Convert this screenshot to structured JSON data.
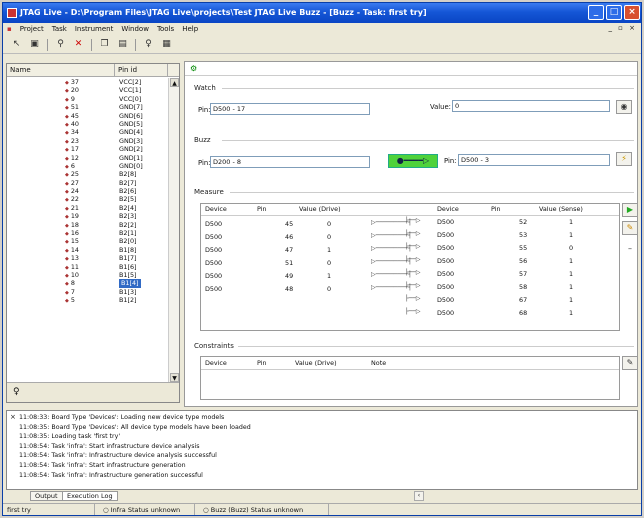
{
  "window": {
    "title": "JTAG Live - D:\\Program Files\\JTAG Live\\projects\\Test JTAG Live Buzz - [Buzz - Task: first try]"
  },
  "menu": [
    "Project",
    "Task",
    "Instrument",
    "Window",
    "Tools",
    "Help"
  ],
  "left_panel": {
    "col_name": "Name",
    "col_pin": "Pin id",
    "pins": [
      {
        "name": "37",
        "id": "VCC[2]"
      },
      {
        "name": "20",
        "id": "VCC[1]"
      },
      {
        "name": "9",
        "id": "VCC[0]"
      },
      {
        "name": "51",
        "id": "GND[7]"
      },
      {
        "name": "45",
        "id": "GND[6]"
      },
      {
        "name": "40",
        "id": "GND[5]"
      },
      {
        "name": "34",
        "id": "GND[4]"
      },
      {
        "name": "23",
        "id": "GND[3]"
      },
      {
        "name": "17",
        "id": "GND[2]"
      },
      {
        "name": "12",
        "id": "GND[1]"
      },
      {
        "name": "6",
        "id": "GND[0]"
      },
      {
        "name": "25",
        "id": "B2[8]"
      },
      {
        "name": "27",
        "id": "B2[7]"
      },
      {
        "name": "24",
        "id": "B2[6]"
      },
      {
        "name": "22",
        "id": "B2[5]"
      },
      {
        "name": "21",
        "id": "B2[4]"
      },
      {
        "name": "19",
        "id": "B2[3]"
      },
      {
        "name": "18",
        "id": "B2[2]"
      },
      {
        "name": "16",
        "id": "B2[1]"
      },
      {
        "name": "15",
        "id": "B2[0]"
      },
      {
        "name": "14",
        "id": "B1[8]"
      },
      {
        "name": "13",
        "id": "B1[7]"
      },
      {
        "name": "11",
        "id": "B1[6]"
      },
      {
        "name": "10",
        "id": "B1[5]"
      },
      {
        "name": "8",
        "id": "B1[4]",
        "selected": true
      },
      {
        "name": "7",
        "id": "B1[3]"
      },
      {
        "name": "5",
        "id": "B1[2]"
      }
    ]
  },
  "watch": {
    "group": "Watch",
    "pin_label": "Pin:",
    "pin_value": "D500 - 17",
    "value_label": "Value:",
    "value": "0"
  },
  "buzz": {
    "group": "Buzz",
    "pin_label": "Pin:",
    "pin_from": "D200 - 8",
    "pin_to": "D500 - 3"
  },
  "measure": {
    "group": "Measure",
    "left_headers": [
      "Device",
      "Pin",
      "Value (Drive)"
    ],
    "right_headers": [
      "Device",
      "Pin",
      "Value (Sense)"
    ],
    "drive": [
      [
        "D500",
        "45",
        "0"
      ],
      [
        "D500",
        "46",
        "0"
      ],
      [
        "D500",
        "47",
        "1"
      ],
      [
        "D500",
        "51",
        "0"
      ],
      [
        "D500",
        "49",
        "1"
      ],
      [
        "D500",
        "48",
        "0"
      ]
    ],
    "sense": [
      [
        "D500",
        "52",
        "1"
      ],
      [
        "D500",
        "53",
        "1"
      ],
      [
        "D500",
        "55",
        "0"
      ],
      [
        "D500",
        "56",
        "1"
      ],
      [
        "D500",
        "57",
        "1"
      ],
      [
        "D500",
        "58",
        "1"
      ],
      [
        "D500",
        "67",
        "1"
      ],
      [
        "D500",
        "68",
        "1"
      ]
    ]
  },
  "constraints": {
    "group": "Constraints",
    "headers": [
      "Device",
      "Pin",
      "Value (Drive)",
      "Note"
    ]
  },
  "log": [
    "11:08:33: Board Type 'Devices': Loading new device type models",
    "11:08:35: Board Type 'Devices': All device type models have been loaded",
    "11:08:35: Loading task 'first try'",
    "11:08:54: Task 'infra': Start infrastructure device analysis",
    "11:08:54: Task 'infra': Infrastructure device analysis successful",
    "11:08:54: Task 'infra': Start infrastructure generation",
    "11:08:54: Task 'infra': Infrastructure generation successful"
  ],
  "tabs": {
    "output": "Output",
    "exec": "Execution Log"
  },
  "status": {
    "task": "first try",
    "infra": "Infra",
    "infra_status": "Status unknown",
    "buzz": "Buzz (Buzz)",
    "buzz_status": "Status unknown"
  }
}
